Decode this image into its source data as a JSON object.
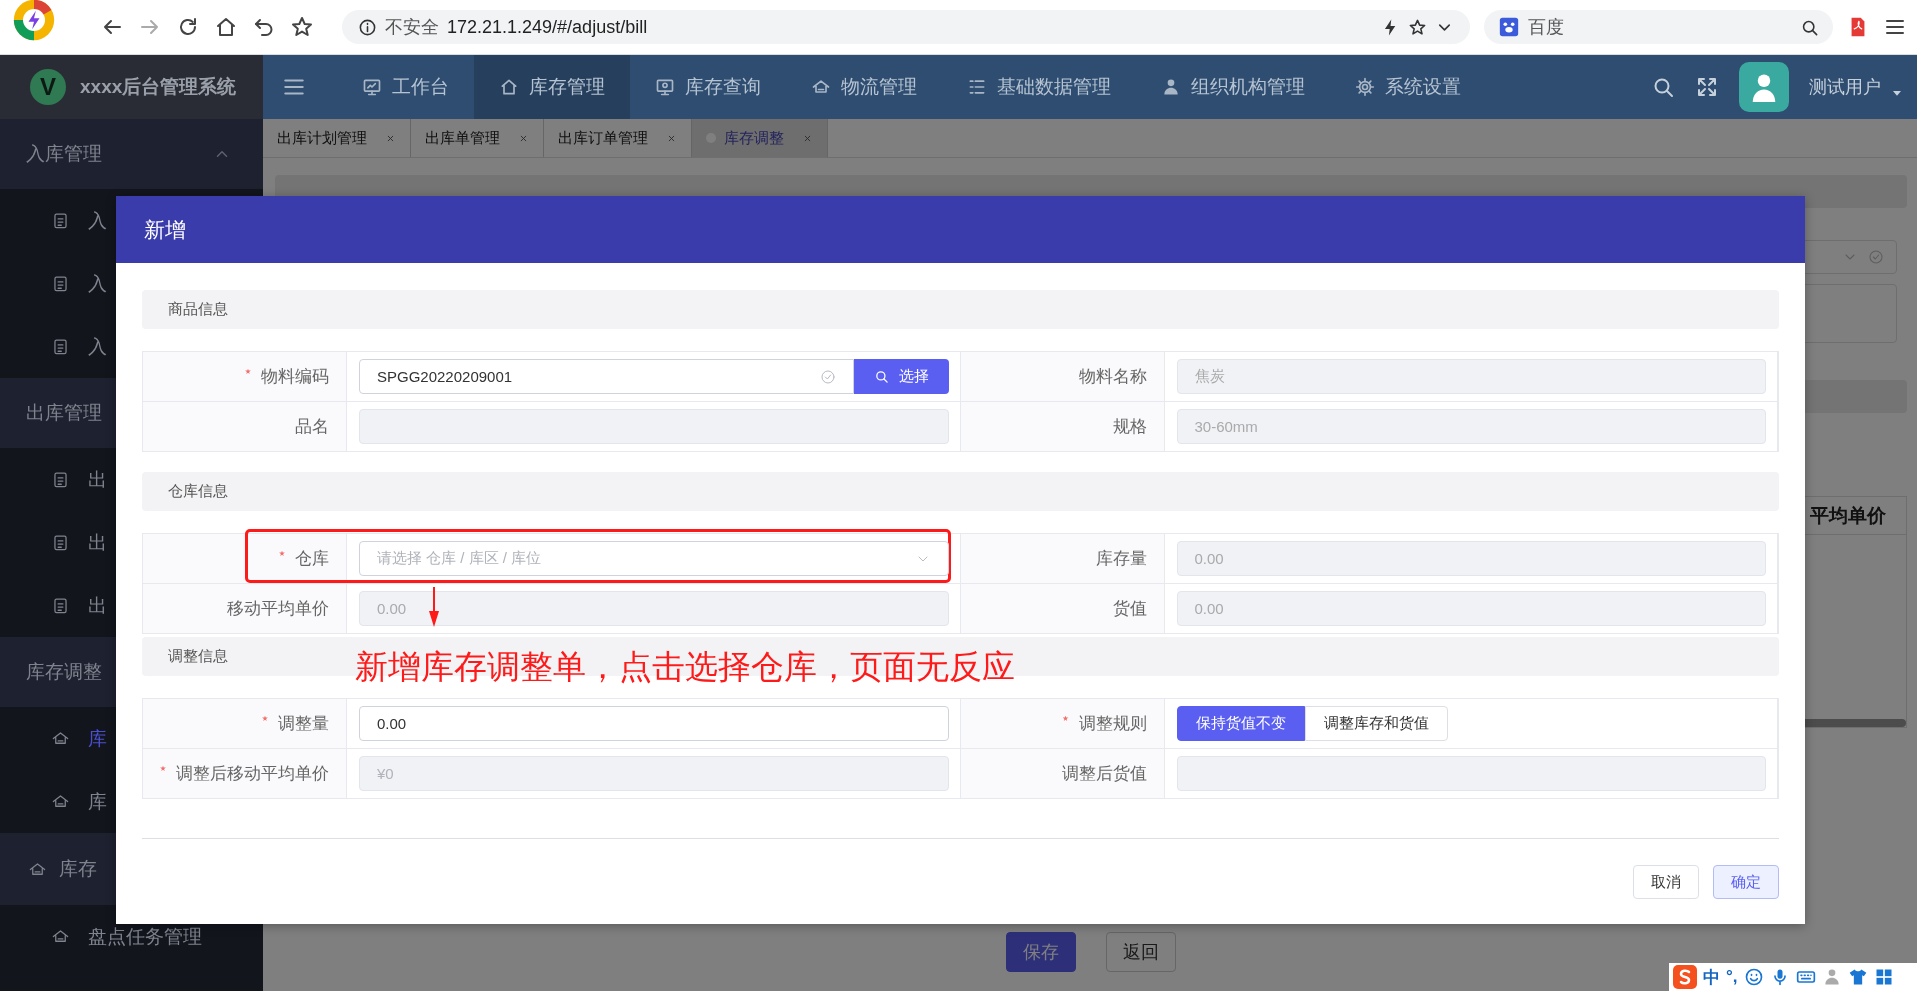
{
  "browser": {
    "security": "不安全",
    "url": "172.21.1.249/#/adjust/bill",
    "search_placeholder": "百度"
  },
  "app": {
    "logo_letter": "V",
    "title": "xxxx后台管理系统"
  },
  "nav": [
    {
      "label": "工作台",
      "selected": false
    },
    {
      "label": "库存管理",
      "selected": true
    },
    {
      "label": "库存查询",
      "selected": false
    },
    {
      "label": "物流管理",
      "selected": false
    },
    {
      "label": "基础数据管理",
      "selected": false
    },
    {
      "label": "组织机构管理",
      "selected": false
    },
    {
      "label": "系统设置",
      "selected": false
    }
  ],
  "user": {
    "name": "测试用户"
  },
  "tabs": [
    {
      "label": "出库计划管理",
      "selected": false
    },
    {
      "label": "出库单管理",
      "selected": false
    },
    {
      "label": "出库订单管理",
      "selected": false
    },
    {
      "label": "库存调整",
      "selected": true
    }
  ],
  "sidebar": [
    {
      "label": "入库管理",
      "kind": "group",
      "expanded": true,
      "children": [
        {
          "label": "入",
          "kind": "document",
          "selected": false
        },
        {
          "label": "入",
          "kind": "document",
          "selected": false
        },
        {
          "label": "入",
          "kind": "document",
          "selected": false
        }
      ]
    },
    {
      "label": "出库管理",
      "kind": "group",
      "children": [
        {
          "label": "出",
          "kind": "document",
          "selected": false
        },
        {
          "label": "出",
          "kind": "document",
          "selected": false
        },
        {
          "label": "出",
          "kind": "document",
          "selected": false
        }
      ]
    },
    {
      "label": "库存调整",
      "kind": "group",
      "children": [
        {
          "label": "库",
          "kind": "home",
          "selected": true
        },
        {
          "label": "库",
          "kind": "home",
          "selected": false
        }
      ]
    },
    {
      "label": "库存",
      "kind": "subgroup",
      "children": [
        {
          "label": "盘点任务管理",
          "kind": "home",
          "selected": false
        }
      ]
    }
  ],
  "background_page": {
    "table_column": "平均单价",
    "buttons": [
      {
        "label": "保存",
        "kind": "primary"
      },
      {
        "label": "返回",
        "kind": "default"
      }
    ]
  },
  "dialog": {
    "title": "新增",
    "sections": [
      {
        "title": "商品信息",
        "rows": [
          [
            {
              "label": "物料编码",
              "required": true,
              "kind": "picker",
              "disabled": false,
              "value": "SPGG20220209001",
              "button": "选择"
            },
            {
              "label": "物料名称",
              "required": false,
              "kind": "input",
              "disabled": true,
              "value": "焦炭"
            }
          ],
          [
            {
              "label": "品名",
              "required": false,
              "kind": "input",
              "disabled": true
            },
            {
              "label": "规格",
              "required": false,
              "kind": "input",
              "disabled": true,
              "value": "30-60mm"
            }
          ]
        ]
      },
      {
        "title": "仓库信息",
        "rows": [
          [
            {
              "label": "仓库",
              "required": true,
              "kind": "select",
              "disabled": false,
              "placeholder": "请选择 仓库 / 库区 / 库位",
              "highlighted": true
            },
            {
              "label": "库存量",
              "required": false,
              "kind": "input",
              "disabled": true,
              "value": "0.00"
            }
          ],
          [
            {
              "label": "移动平均单价",
              "required": false,
              "kind": "input",
              "disabled": true,
              "value": "0.00"
            },
            {
              "label": "货值",
              "required": false,
              "kind": "input",
              "disabled": true,
              "value": "0.00"
            }
          ]
        ]
      },
      {
        "title": "调整信息",
        "rows": [
          [
            {
              "label": "调整量",
              "required": true,
              "kind": "input",
              "disabled": false,
              "value": "0.00"
            },
            {
              "label": "调整规则",
              "required": true,
              "kind": "segmented",
              "options": [
                {
                  "label": "保持货值不变",
                  "selected": true
                },
                {
                  "label": "调整库存和货值",
                  "selected": false
                }
              ]
            }
          ],
          [
            {
              "label": "调整后移动平均单价",
              "required": true,
              "kind": "input",
              "disabled": true,
              "placeholder": "¥0"
            },
            {
              "label": "调整后货值",
              "required": false,
              "kind": "input",
              "disabled": true
            }
          ]
        ]
      }
    ],
    "footer": [
      {
        "label": "取消",
        "kind": "default"
      },
      {
        "label": "确定",
        "kind": "primary"
      }
    ]
  },
  "annotation": {
    "text": "新增库存调整单，点击选择仓库，页面无反应"
  },
  "ime": {
    "mode": "中",
    "punctuation": "°,"
  }
}
